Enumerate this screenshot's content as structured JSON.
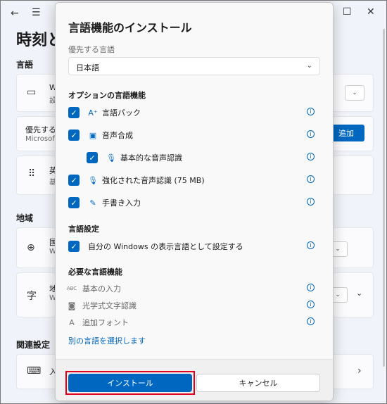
{
  "background": {
    "title": "時刻と",
    "sections": {
      "language": "言語",
      "region": "地域",
      "related": "関連設定"
    },
    "rows": {
      "r1_title": "W",
      "r1_sub": "設",
      "r2_title": "優先する",
      "r2_sub": "Microsoft",
      "r3_title": "英",
      "r3_sub": "基",
      "r4_title": "国",
      "r4_sub": "W",
      "r5_title": "地",
      "r5_sub": "W",
      "r6_title": "入"
    },
    "add_button": "追加"
  },
  "dialog": {
    "title": "言語機能のインストール",
    "preferred_label": "優先する言語",
    "preferred_value": "日本語",
    "optional_header": "オプションの言語機能",
    "optional_items": [
      {
        "label": "言語パック",
        "checked": true
      },
      {
        "label": "音声合成",
        "checked": true
      },
      {
        "label": "基本的な音声認識",
        "checked": true
      },
      {
        "label": "強化された音声認識 (75 MB)",
        "checked": true
      },
      {
        "label": "手書き入力",
        "checked": true
      }
    ],
    "settings_header": "言語設定",
    "settings_item": "自分の Windows の表示言語として設定する",
    "required_header": "必要な言語機能",
    "required_items": [
      {
        "icon_text": "ABC",
        "label": "基本の入力"
      },
      {
        "label": "光学式文字認識"
      },
      {
        "label": "追加フォント"
      }
    ],
    "link": "別の言語を選択します",
    "install_button": "インストール",
    "cancel_button": "キャンセル"
  },
  "colors": {
    "accent": "#0067c0",
    "highlight": "#e0001b"
  }
}
